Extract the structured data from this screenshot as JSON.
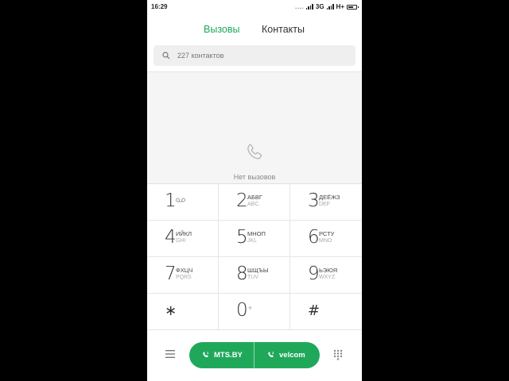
{
  "status_bar": {
    "time": "16:29",
    "dots": "....",
    "network_1": "3G",
    "network_2": "H+"
  },
  "tabs": [
    {
      "label": "Вызовы",
      "active": true
    },
    {
      "label": "Контакты",
      "active": false
    }
  ],
  "search": {
    "placeholder": "227 контактов"
  },
  "empty_state": {
    "text": "Нет вызовов",
    "icon": "phone-icon"
  },
  "keypad": [
    {
      "digit": "1",
      "letters_ru": "",
      "letters_en": "",
      "icon": "voicemail-icon"
    },
    {
      "digit": "2",
      "letters_ru": "АБВГ",
      "letters_en": "ABC"
    },
    {
      "digit": "3",
      "letters_ru": "ДЕЁЖЗ",
      "letters_en": "DEF"
    },
    {
      "digit": "4",
      "letters_ru": "ИЙКЛ",
      "letters_en": "GHI"
    },
    {
      "digit": "5",
      "letters_ru": "МНОП",
      "letters_en": "JKL"
    },
    {
      "digit": "6",
      "letters_ru": "РСТУ",
      "letters_en": "MNO"
    },
    {
      "digit": "7",
      "letters_ru": "ФХЦЧ",
      "letters_en": "PQRS"
    },
    {
      "digit": "8",
      "letters_ru": "ШЩЪЫ",
      "letters_en": "TUV"
    },
    {
      "digit": "9",
      "letters_ru": "ЬЭЮЯ",
      "letters_en": "WXYZ"
    },
    {
      "digit": "∗",
      "letters_ru": "",
      "letters_en": ""
    },
    {
      "digit": "0",
      "letters_ru": "+",
      "letters_en": ""
    },
    {
      "digit": "#",
      "letters_ru": "",
      "letters_en": ""
    }
  ],
  "bottom_bar": {
    "sim1_label": "MTS.BY",
    "sim2_label": "velcom",
    "menu_icon": "hamburger-menu-icon",
    "dialpad_icon": "dialpad-grid-icon"
  },
  "colors": {
    "accent": "#1fa85a",
    "empty_bg": "#f5f5f5",
    "search_bg": "#efefef"
  }
}
